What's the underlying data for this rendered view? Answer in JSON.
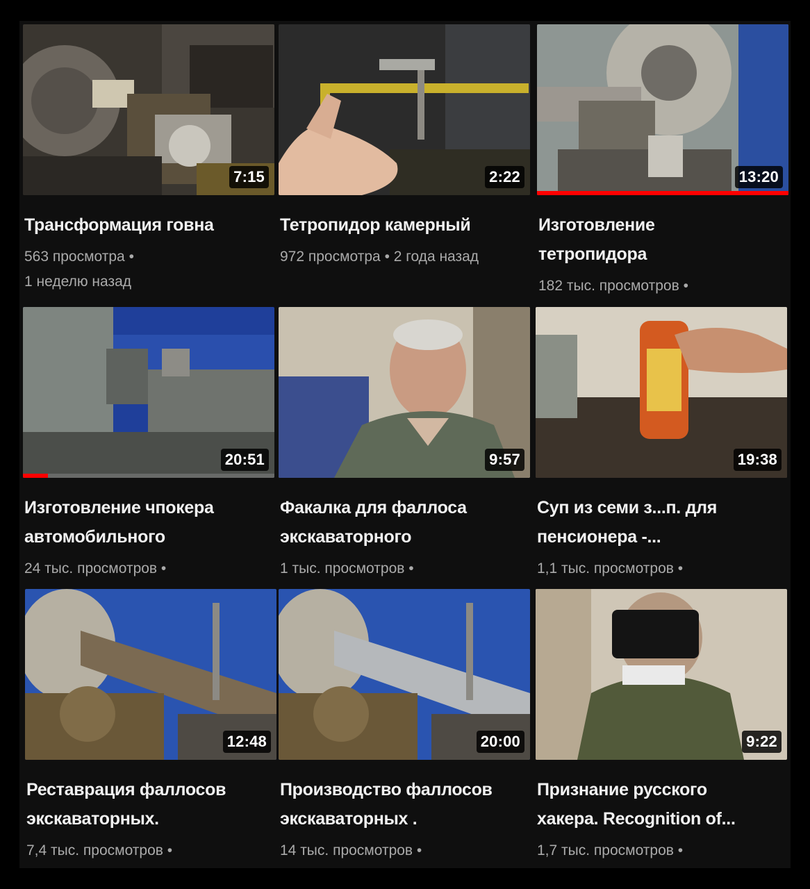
{
  "colors": {
    "background": "#0f0f0f",
    "title": "#f1f1f1",
    "meta": "#aaaaaa",
    "progress": "#ff0000",
    "duration_bg": "#000000"
  },
  "videos": [
    {
      "title": "Трансформация говна",
      "meta_line1": "563 просмотра •",
      "meta_line2": "1 неделю назад",
      "duration": "7:15",
      "progress": 0,
      "thumb_scene": "lathe-chuck-shavings"
    },
    {
      "title": "Тетропидор камерный",
      "meta_line1": "972 просмотра • 2 года назад",
      "meta_line2": "",
      "duration": "2:22",
      "progress": 0,
      "thumb_scene": "hand-yellow-pipe"
    },
    {
      "title": "Изготовление тетропидора",
      "meta_line1": "182 тыс. просмотров •",
      "meta_line2": "",
      "duration": "13:20",
      "progress": 1.0,
      "thumb_scene": "lathe-toolpost"
    },
    {
      "title": "Изготовление чпокера автомобильного",
      "meta_line1": "24 тыс. просмотров •",
      "meta_line2": "",
      "duration": "20:51",
      "progress": 0.1,
      "thumb_scene": "lathe-machine-blue-wall"
    },
    {
      "title": "Факалка для фаллоса экскаваторного",
      "meta_line1": "1 тыс. просмотров •",
      "meta_line2": "",
      "duration": "9:57",
      "progress": 0,
      "thumb_scene": "old-man-workshop"
    },
    {
      "title": "Суп из семи з...п. для пенсионера -...",
      "meta_line1": "1,1 тыс. просмотров •",
      "meta_line2": "",
      "duration": "19:38",
      "progress": 0,
      "thumb_scene": "hand-holding-bottle"
    },
    {
      "title": "Реставрация фаллосов экскаваторных.",
      "meta_line1": "7,4 тыс. просмотров •",
      "meta_line2": "",
      "duration": "12:48",
      "progress": 0,
      "thumb_scene": "lathe-shaft-rusty"
    },
    {
      "title": "Производство фаллосов экскаваторных .",
      "meta_line1": "14 тыс. просмотров •",
      "meta_line2": "",
      "duration": "20:00",
      "progress": 0,
      "thumb_scene": "lathe-shaft-polished"
    },
    {
      "title": "Признание русского хакера. Recognition of...",
      "meta_line1": "1,7 тыс. просмотров •",
      "meta_line2": "",
      "duration": "9:22",
      "progress": 0,
      "thumb_scene": "masked-man-camo"
    }
  ]
}
